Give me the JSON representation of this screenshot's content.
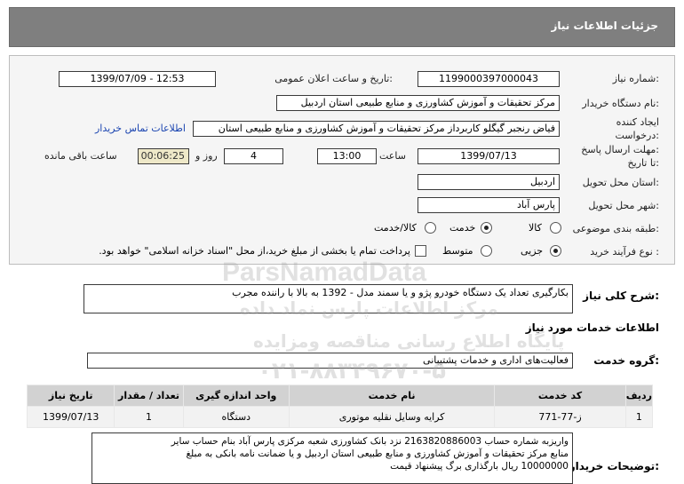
{
  "header": {
    "title": "جزئیات اطلاعات نیاز"
  },
  "fields": {
    "need_number_label": "شماره نیاز:",
    "need_number": "1199000397000043",
    "announce_label": "تاریخ و ساعت اعلان عمومی:",
    "announce_value": "1399/07/09 - 12:53",
    "buyer_label": "نام دستگاه خریدار:",
    "buyer_value": "مرکز تحقیقات و آموزش کشاورزی و منابع طبیعی استان اردبیل",
    "creator_label_1": "ایجاد کننده",
    "creator_label_2": "درخواست:",
    "creator_value": "فیاض رنجبر گیگلو کاربرداز مرکز تحقیقات و آموزش کشاورزی و منابع طبیعی استان",
    "contact_link": "اطلاعات تماس خریدار",
    "deadline_label_1": "مهلت ارسال پاسخ:",
    "deadline_label_2": "تا تاریخ:",
    "deadline_date": "1399/07/13",
    "time_label": "ساعت",
    "deadline_time": "13:00",
    "days_value": "4",
    "days_label": "روز و",
    "remaining_time": "00:06:25",
    "remaining_label": "ساعت باقی مانده",
    "province_label": "استان محل تحویل:",
    "province_value": "اردبیل",
    "city_label": "شهر محل تحویل:",
    "city_value": "پارس آباد",
    "category_label": "طبقه بندی موضوعی:",
    "category_options": [
      "کالا",
      "خدمت",
      "کالا/خدمت"
    ],
    "category_selected": "خدمت",
    "process_label": "نوع فرآیند خرید :",
    "process_options": [
      "جزیی",
      "متوسط"
    ],
    "process_selected": "جزیی",
    "payment_note": "پرداخت تمام یا بخشی از مبلغ خرید،از محل \"اسناد خزانه اسلامی\" خواهد بود."
  },
  "description": {
    "label": "شرح کلی نیاز:",
    "value": "بکارگیری تعداد یک دستگاه خودرو پژو و یا سمند مدل - 1392 به بالا با راننده مجرب"
  },
  "services": {
    "section_title": "اطلاعات خدمات مورد نیاز",
    "group_label": "گروه خدمت:",
    "group_value": "فعالیت‌های اداری و خدمات پشتیبانی"
  },
  "table": {
    "headers": [
      "ردیف",
      "کد خدمت",
      "نام خدمت",
      "واحد اندازه گیری",
      "تعداد / مقدار",
      "تاریخ نیاز"
    ],
    "rows": [
      [
        "1",
        "ز-77-771",
        "کرایه وسایل نقلیه موتوری",
        "دستگاه",
        "1",
        "1399/07/13"
      ]
    ]
  },
  "buyer_notes": {
    "label": "توضیحات خریدار:",
    "lines": [
      "واریزبه شماره حساب 2163820886003 نزد بانک کشاورزی شعبه مرکزی پارس آباد بنام حساب سایر",
      "منابع مرکز تحقیقات و آموزش کشاورزی و منابع طبیعی استان اردبیل و یا ضمانت نامه بانکی به مبلغ",
      "10000000 ریال بارگذاری برگ پیشنهاد قیمت"
    ]
  },
  "watermark": {
    "brand": "ParsNamadData",
    "line1": "مرکز اطلاعات پارس نماد داده",
    "line2": "پایگاه اطلاع رسانی مناقصه ومزایده",
    "phone": "۰۲۱-۸۸۳۴۹۶۷۰-۵"
  }
}
